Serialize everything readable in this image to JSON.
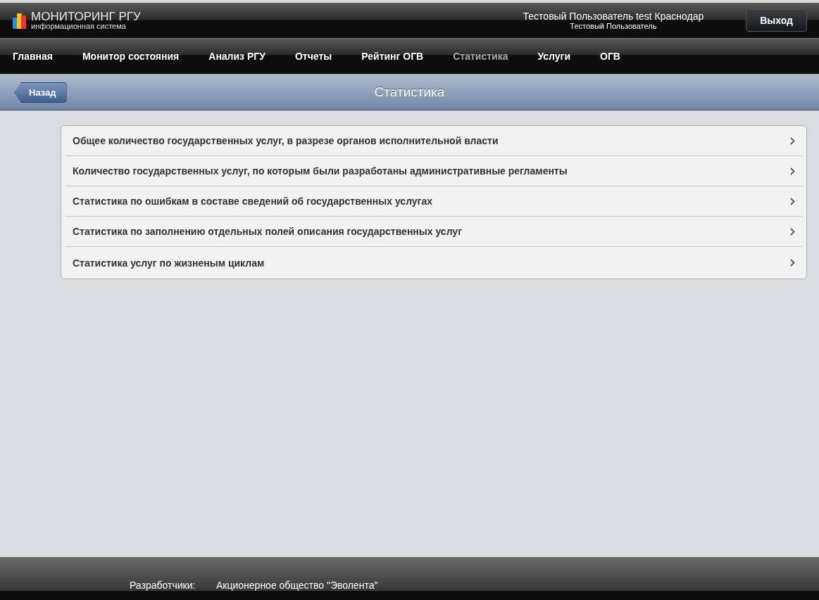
{
  "header": {
    "logo_title": "МОНИТОРИНГ РГУ",
    "logo_subtitle": "информационная система",
    "user_line": "Тестовый Пользователь test Краснодар",
    "user_name": "Тестовый Пользователь",
    "logout_button": "Выход"
  },
  "nav": [
    {
      "label": "Главная",
      "selected": false
    },
    {
      "label": "Монитор состояния",
      "selected": false
    },
    {
      "label": "Анализ РГУ",
      "selected": false
    },
    {
      "label": "Отчеты",
      "selected": false
    },
    {
      "label": "Рейтинг ОГВ",
      "selected": false
    },
    {
      "label": "Статистика",
      "selected": true
    },
    {
      "label": "Услуги",
      "selected": false
    },
    {
      "label": "ОГВ",
      "selected": false
    }
  ],
  "title_bar": {
    "back_button": "Назад",
    "title": "Статистика"
  },
  "list": [
    {
      "label": "Общее количество государственных услуг, в разрезе органов исполнительной власти"
    },
    {
      "label": "Количество государственных услуг, по которым были разработаны административные регламенты"
    },
    {
      "label": "Статистика по ошибкам в составе сведений об государственных услугах"
    },
    {
      "label": "Статистика по заполнению отдельных полей описания государственных услуг"
    },
    {
      "label": "Статистика услуг по жизненым циклам"
    }
  ],
  "footer": {
    "label": "Разработчики:",
    "value": "Акционерное общество \"Эволента\""
  }
}
